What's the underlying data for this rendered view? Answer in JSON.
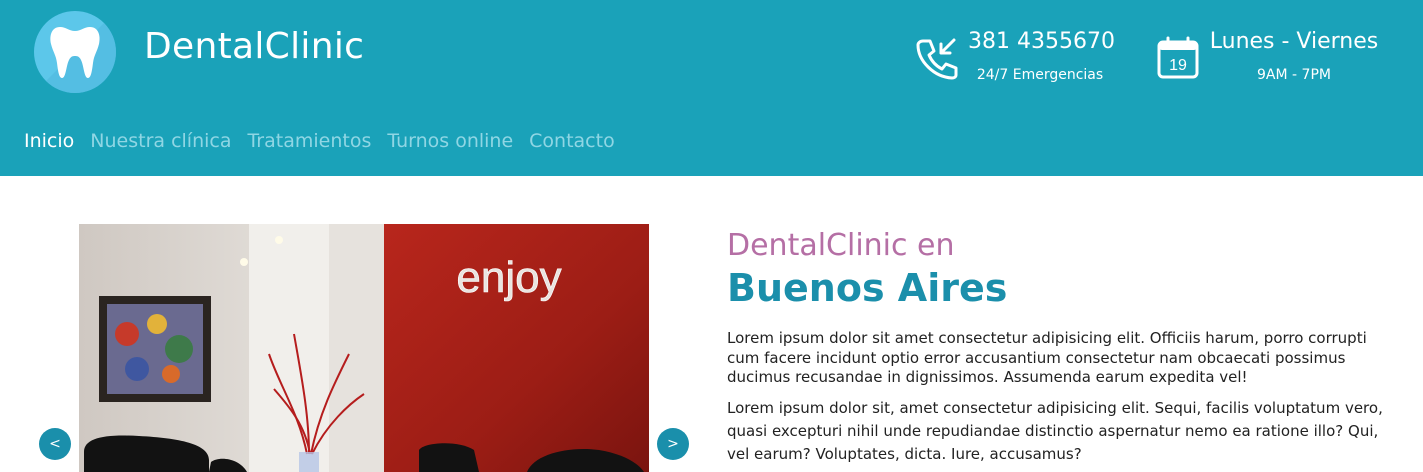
{
  "brand": {
    "name": "DentalClinic",
    "logo_icon": "tooth-icon"
  },
  "contact": {
    "phone": {
      "number": "381 4355670",
      "note": "24/7 Emergencias",
      "icon": "phone-incoming-icon"
    },
    "hours": {
      "days": "Lunes - Viernes",
      "time": "9AM - 7PM",
      "icon": "calendar-icon",
      "calendar_day": "19"
    }
  },
  "nav": {
    "items": [
      {
        "label": "Inicio",
        "active": true
      },
      {
        "label": "Nuestra clínica",
        "active": false
      },
      {
        "label": "Tratamientos",
        "active": false
      },
      {
        "label": "Turnos online",
        "active": false
      },
      {
        "label": "Contacto",
        "active": false
      }
    ]
  },
  "slider": {
    "prev_label": "<",
    "next_label": ">",
    "wall_text": "enjoy"
  },
  "hero": {
    "subtitle": "DentalClinic en",
    "title": "Buenos Aires",
    "paragraph1": "Lorem ipsum dolor sit amet consectetur adipisicing elit. Officiis harum, porro corrupti cum facere incidunt optio error accusantium consectetur nam obcaecati possimus ducimus recusandae in dignissimos. Assumenda earum expedita vel!",
    "paragraph2": "Lorem ipsum dolor sit, amet consectetur adipisicing elit. Sequi, facilis voluptatum vero, quasi excepturi nihil unde repudiandae distinctio aspernatur nemo ea ratione illo? Qui, vel earum? Voluptates, dicta. Iure, accusamus?"
  },
  "colors": {
    "header_bg": "#1aa2b9",
    "accent_blue": "#1b8fab",
    "accent_purple": "#b56fa5",
    "nav_inactive": "#8fd6e4"
  }
}
